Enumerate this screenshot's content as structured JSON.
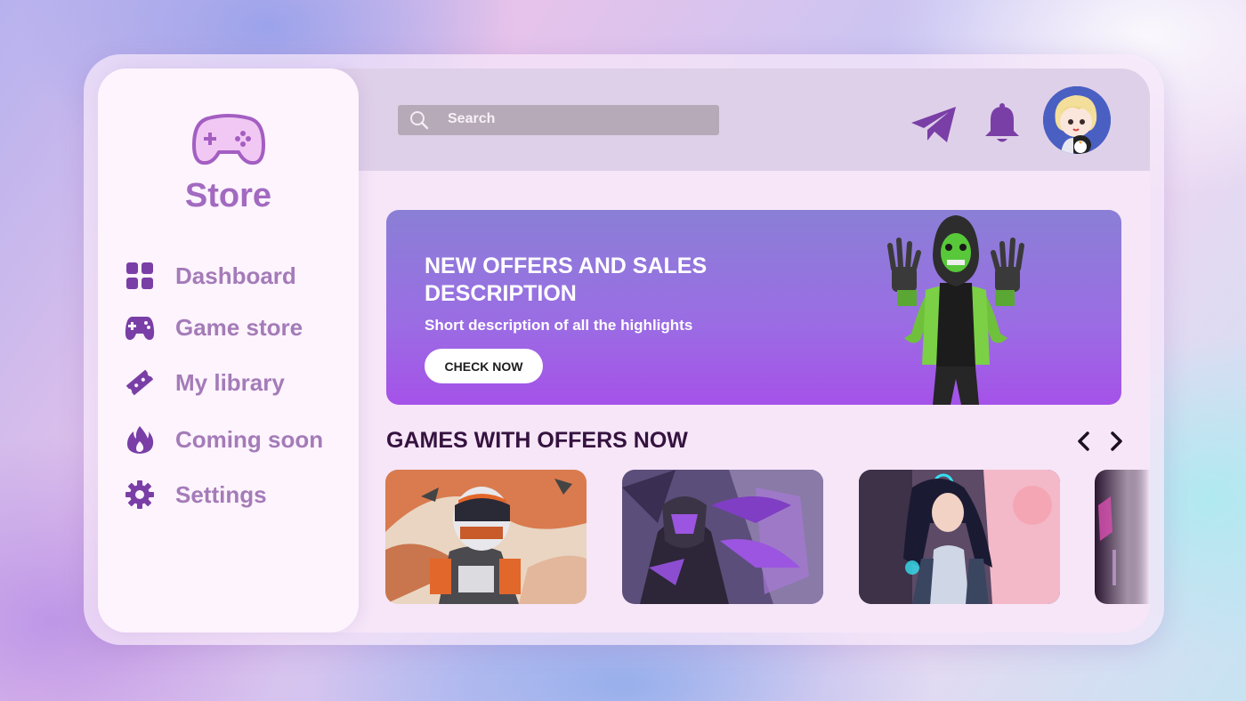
{
  "brand": {
    "name": "Store",
    "icon": "gamepad-icon"
  },
  "sidebar": {
    "items": [
      {
        "label": "Dashboard",
        "icon": "grid-icon"
      },
      {
        "label": "Game store",
        "icon": "gamepad-icon"
      },
      {
        "label": "My library",
        "icon": "ticket-icon"
      },
      {
        "label": "Coming soon",
        "icon": "flame-icon"
      },
      {
        "label": "Settings",
        "icon": "gear-icon"
      }
    ]
  },
  "header": {
    "search": {
      "placeholder": "Search",
      "icon": "search-icon"
    },
    "icons": [
      "send-icon",
      "bell-icon"
    ],
    "avatar": "user-avatar"
  },
  "banner": {
    "title": "NEW OFFERS AND SALES DESCRIPTION",
    "subtitle": "Short description of  all the highlights",
    "button_label": "CHECK NOW"
  },
  "offers": {
    "title": "GAMES WITH OFFERS NOW",
    "prev_icon": "chevron-left-icon",
    "next_icon": "chevron-right-icon",
    "cards": [
      {
        "art": "astronaut-art"
      },
      {
        "art": "armored-warrior-art"
      },
      {
        "art": "cyber-girl-art"
      },
      {
        "art": "partial-card-art"
      }
    ]
  },
  "colors": {
    "accent": "#a26ac0",
    "nav_text": "#a47bb8",
    "icon_purple": "#7a3fa6",
    "banner_top": "#8a7fd6",
    "banner_bottom": "#a552e8",
    "heading": "#35123f"
  }
}
